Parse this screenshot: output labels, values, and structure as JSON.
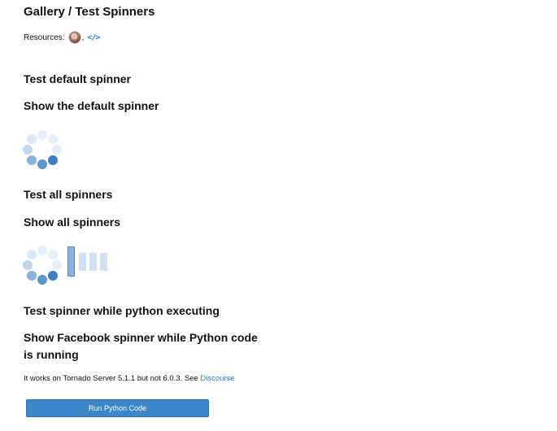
{
  "page": {
    "title": "Gallery / Test Spinners",
    "resources_label": "Resources:",
    "resources_separator": ",",
    "code_icon_glyph": "</>"
  },
  "sections": [
    {
      "heading": "Test default spinner",
      "subheading": "Show the default spinner"
    },
    {
      "heading": "Test all spinners",
      "subheading": "Show all spinners"
    },
    {
      "heading": "Test spinner while python executing",
      "subheading": "Show Facebook spinner while Python code is running"
    }
  ],
  "note": {
    "text": "It works on Tornado Server 5.1.1 but not 6.0.3. See ",
    "link_label": "Discourse"
  },
  "run_button": {
    "label": "Run Python Code"
  },
  "colors": {
    "accent": "#3b87c9",
    "spinner_dark": "#3b7fc4",
    "spinner_light": "#dce8f3",
    "link": "#2a78c8"
  },
  "icons": [
    "avatar",
    "code-icon",
    "spinner-icon",
    "facebook-spinner-icon"
  ]
}
